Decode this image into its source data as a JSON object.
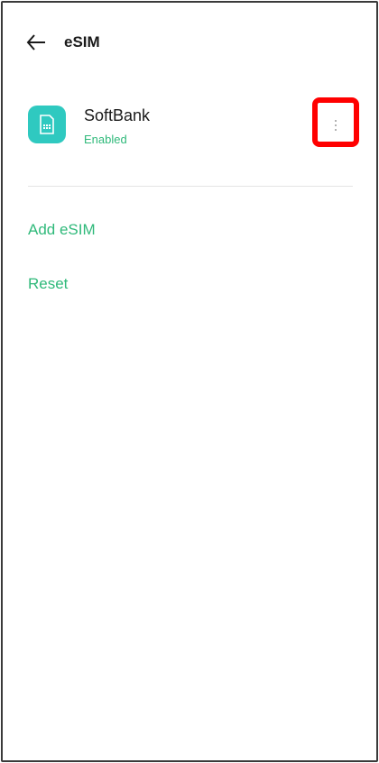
{
  "header": {
    "title": "eSIM",
    "back_icon": "arrow-left-icon"
  },
  "sim": {
    "carrier": "SoftBank",
    "status": "Enabled",
    "icon": "sim-card-icon",
    "icon_color": "#2fc9c0",
    "more_icon": "more-vertical-icon"
  },
  "actions": {
    "add_label": "Add eSIM",
    "reset_label": "Reset"
  },
  "colors": {
    "accent": "#2fb97a",
    "highlight": "#ff0000"
  }
}
